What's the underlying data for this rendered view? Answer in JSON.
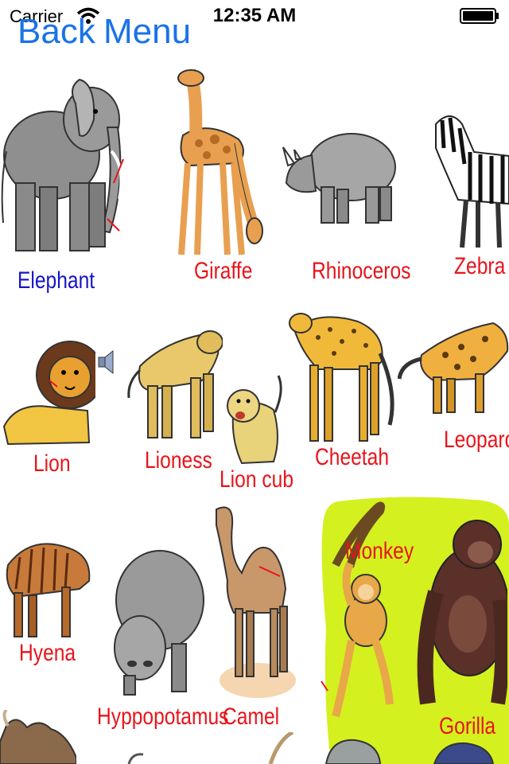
{
  "status_bar": {
    "carrier": "Carrier",
    "time": "12:35 AM",
    "icons": [
      "wifi-icon",
      "battery-icon"
    ]
  },
  "nav": {
    "back_label": "Back",
    "menu_label": "Menu",
    "accent": "#1a73e8"
  },
  "animals": {
    "elephant": "Elephant",
    "giraffe": "Giraffe",
    "rhinoceros": "Rhinoceros",
    "zebra": "Zebra",
    "lion": "Lion",
    "lioness": "Lioness",
    "lion_cub": "Lion cub",
    "cheetah": "Cheetah",
    "leopard": "Leopard",
    "hyena": "Hyena",
    "hippopotamus": "Hyppopotamus",
    "camel": "Camel",
    "monkey": "Monkey",
    "gorilla": "Gorilla"
  },
  "colors": {
    "label_red": "#e8141a",
    "label_selected_blue": "#1515c8",
    "jungle_green": "#d4f01e"
  },
  "selected_animal": "elephant"
}
